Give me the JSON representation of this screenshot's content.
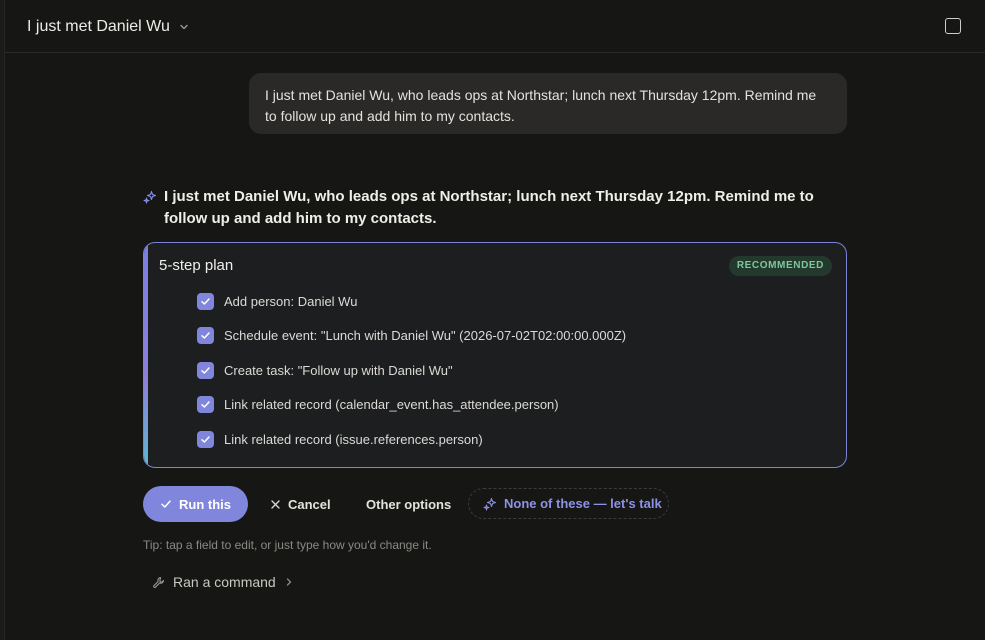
{
  "header": {
    "title": "I just met Daniel Wu"
  },
  "user_message": {
    "text": "I just met Daniel Wu, who leads ops at Northstar; lunch next Thursday 12pm. Remind me to follow up and add him to my contacts."
  },
  "assistant": {
    "echo_text": "I just met Daniel Wu, who leads ops at Northstar; lunch next Thursday 12pm. Remind me to follow up and add him to my contacts."
  },
  "plan": {
    "title": "5-step plan",
    "badge": "RECOMMENDED",
    "steps": [
      {
        "label": "Add person: Daniel Wu",
        "checked": true
      },
      {
        "label": "Schedule event: \"Lunch with Daniel Wu\" (2026-07-02T02:00:00.000Z)",
        "checked": true
      },
      {
        "label": "Create task: \"Follow up with Daniel Wu\"",
        "checked": true
      },
      {
        "label": "Link related record (calendar_event.has_attendee.person)",
        "checked": true
      },
      {
        "label": "Link related record (issue.references.person)",
        "checked": true
      }
    ]
  },
  "actions": {
    "run_label": "Run this",
    "cancel_label": "Cancel",
    "other_label": "Other options",
    "none_label": "None of these — let's talk"
  },
  "tip": "Tip: tap a field to edit, or just type how you'd change it.",
  "command": {
    "label": "Ran a command"
  },
  "colors": {
    "background": "#161614",
    "accent": "#7f86dc",
    "badge_bg": "#23392e",
    "badge_text": "#7fc79b",
    "bubble": "#2a2927"
  },
  "icons": {
    "title_chevron": "chevron-down-icon",
    "top_right": "square-icon",
    "assistant": "sparkles-icon",
    "step_check": "check-icon",
    "run": "check-icon",
    "cancel": "close-icon",
    "none": "sparkles-icon",
    "command": "wrench-icon",
    "command_chevron": "chevron-right-icon"
  }
}
